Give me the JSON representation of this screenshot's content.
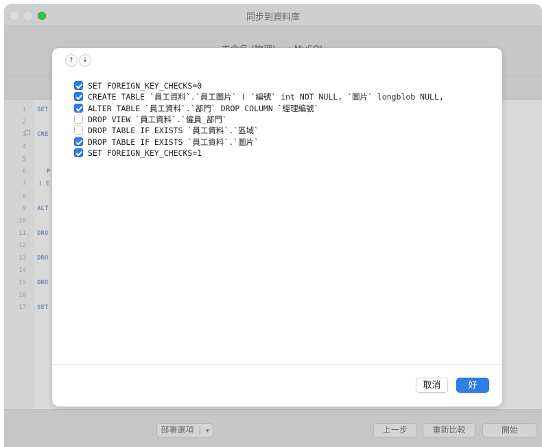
{
  "window": {
    "title": "同步到資料庫",
    "header_text": "未命名 (物理)  ⟶  MySQL"
  },
  "editor": {
    "line_numbers": [
      "1",
      "2",
      "3",
      "4",
      "5",
      "6",
      "7",
      "8",
      "9",
      "10",
      "11",
      "12",
      "13",
      "14",
      "15",
      "16",
      "17"
    ],
    "visible_code": {
      "l1": "SET",
      "l3": "CRE",
      "l6": "P",
      "l7": ") E",
      "l9": "ALT",
      "l11": "DRO",
      "l13": "DRO",
      "l15": "DRO",
      "l17": "SET"
    }
  },
  "bottom_bar": {
    "deploy_options_label": "部署選項",
    "deploy_options_arrow": "▾",
    "previous_label": "上一步",
    "recompare_label": "重新比較",
    "start_label": "開始"
  },
  "sheet": {
    "move_up_glyph": "↑",
    "move_down_glyph": "↓",
    "statements": [
      {
        "checked": true,
        "sql": "SET FOREIGN_KEY_CHECKS=0"
      },
      {
        "checked": true,
        "sql": "CREATE TABLE `員工資料`.`員工圖片` ( `編號` int NOT NULL, `圖片` longblob NULL,"
      },
      {
        "checked": true,
        "sql": "ALTER TABLE `員工資料`.`部門` DROP COLUMN `經理編號`"
      },
      {
        "checked": false,
        "sql": "DROP VIEW `員工資料`.`僱員_部門`"
      },
      {
        "checked": false,
        "sql": "DROP TABLE IF EXISTS `員工資料`.`區域`"
      },
      {
        "checked": true,
        "sql": "DROP TABLE IF EXISTS `員工資料`.`圖片`"
      },
      {
        "checked": true,
        "sql": "SET FOREIGN_KEY_CHECKS=1"
      }
    ],
    "cancel_label": "取消",
    "ok_label": "好"
  },
  "colors": {
    "accent": "#2f7de8",
    "zoom_button": "#2ec840"
  }
}
